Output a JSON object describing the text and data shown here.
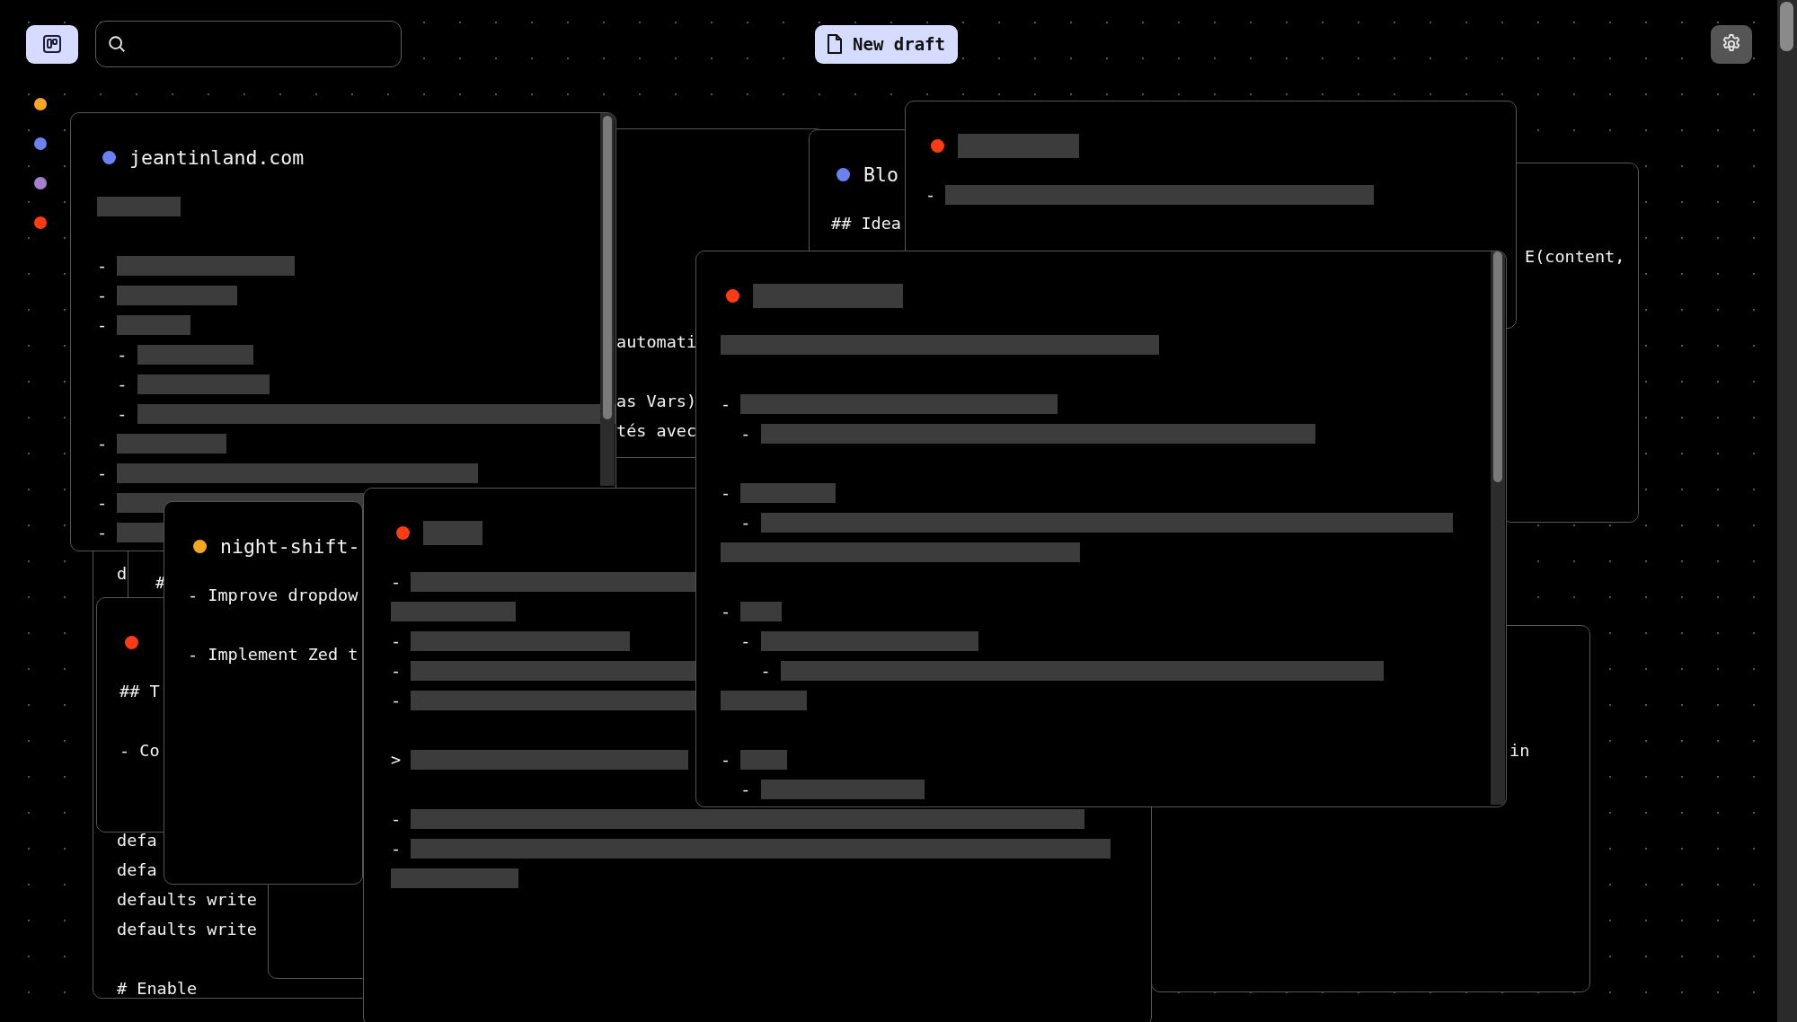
{
  "topbar": {
    "new_draft": {
      "label": "New draft"
    }
  },
  "sidebar": {
    "items": [
      {
        "color": "#f5a623"
      },
      {
        "color": "#6b82f0"
      },
      {
        "color": "#a77fd0"
      },
      {
        "color": "#ff3b13"
      }
    ]
  },
  "cards": [
    {
      "kind": "note",
      "lines": [
        {
          "kind": "text",
          "text": "d"
        },
        {
          "kind": "blank"
        },
        {
          "kind": "blank"
        },
        {
          "kind": "blank"
        },
        {
          "kind": "blank"
        },
        {
          "kind": "blank"
        },
        {
          "kind": "blank"
        },
        {
          "kind": "blank"
        },
        {
          "kind": "blank"
        },
        {
          "kind": "text",
          "text": "defa"
        },
        {
          "kind": "text",
          "text": "defa"
        },
        {
          "kind": "text",
          "text": "defaults write"
        },
        {
          "kind": "text",
          "text": "defaults write"
        },
        {
          "kind": "blank"
        },
        {
          "kind": "text",
          "text": "# Enable"
        }
      ]
    },
    {
      "kind": "note"
    },
    {
      "kind": "note",
      "lines": [
        {
          "kind": "text",
          "text": "#"
        }
      ]
    },
    {
      "kind": "note",
      "color": "#ff3b13",
      "lines": [
        {
          "kind": "text",
          "text": "## T"
        },
        {
          "kind": "blank"
        },
        {
          "kind": "text",
          "text": "- Co"
        }
      ]
    },
    {
      "kind": "note",
      "lines": [
        {
          "kind": "text",
          "text": "automati"
        },
        {
          "kind": "blank"
        },
        {
          "kind": "text",
          "text": "as Vars)"
        },
        {
          "kind": "text",
          "text": "tés avec"
        }
      ]
    },
    {
      "kind": "note",
      "lines": [
        {
          "kind": "text",
          "text": "E(content,"
        }
      ]
    },
    {
      "kind": "note",
      "lines": [
        {
          "kind": "text",
          "text": "in"
        }
      ]
    },
    {
      "kind": "note",
      "color": "#6b82f0",
      "header": {
        "kind": "text",
        "text": "Blo"
      },
      "lines": [
        {
          "kind": "text",
          "text": "## Idea"
        }
      ]
    },
    {
      "kind": "note",
      "color": "#6b82f0",
      "header": {
        "kind": "text",
        "text": "jeantinland.com"
      },
      "lines": [
        {
          "kind": "redacted"
        },
        {
          "kind": "blank"
        },
        {
          "kind": "redacted",
          "prefix": "- "
        },
        {
          "kind": "redacted",
          "prefix": "- "
        },
        {
          "kind": "redacted",
          "prefix": "- "
        },
        {
          "kind": "redacted",
          "prefix": "  - "
        },
        {
          "kind": "redacted",
          "prefix": "  - "
        },
        {
          "kind": "redacted",
          "prefix": "  - "
        },
        {
          "kind": "redacted",
          "prefix": "- "
        },
        {
          "kind": "redacted",
          "prefix": "- "
        },
        {
          "kind": "redacted",
          "prefix": "- "
        },
        {
          "kind": "redacted",
          "prefix": "- "
        }
      ]
    },
    {
      "kind": "note",
      "color": "#f5a623",
      "header": {
        "kind": "text",
        "text": "night-shift-"
      },
      "lines": [
        {
          "kind": "text",
          "text": "- Improve dropdow"
        },
        {
          "kind": "blank"
        },
        {
          "kind": "text",
          "text": "- Implement Zed t"
        }
      ]
    },
    {
      "kind": "note",
      "color": "#ff3b13",
      "header": {
        "kind": "redacted"
      },
      "lines": [
        {
          "kind": "redacted",
          "prefix": "- "
        },
        {
          "kind": "redacted"
        },
        {
          "kind": "redacted",
          "prefix": "- "
        },
        {
          "kind": "redacted",
          "prefix": "- "
        },
        {
          "kind": "redacted",
          "prefix": "- "
        },
        {
          "kind": "blank"
        },
        {
          "kind": "redacted",
          "prefix": "> "
        },
        {
          "kind": "blank"
        },
        {
          "kind": "redacted",
          "prefix": "- "
        },
        {
          "kind": "redacted",
          "prefix": "- "
        },
        {
          "kind": "redacted"
        }
      ]
    },
    {
      "kind": "note",
      "color": "#ff3b13",
      "header": {
        "kind": "redacted"
      },
      "lines": [
        {
          "kind": "redacted",
          "prefix": "- "
        }
      ]
    },
    {
      "kind": "note",
      "color": "#ff3b13",
      "header": {
        "kind": "redacted"
      },
      "lines": [
        {
          "kind": "redacted"
        },
        {
          "kind": "blank"
        },
        {
          "kind": "redacted",
          "prefix": "- "
        },
        {
          "kind": "redacted",
          "prefix": "  - "
        },
        {
          "kind": "blank"
        },
        {
          "kind": "redacted",
          "prefix": "- "
        },
        {
          "kind": "redacted",
          "prefix": "  - "
        },
        {
          "kind": "redacted"
        },
        {
          "kind": "blank"
        },
        {
          "kind": "redacted",
          "prefix": "- "
        },
        {
          "kind": "redacted",
          "prefix": "  - "
        },
        {
          "kind": "redacted",
          "prefix": "    - "
        },
        {
          "kind": "redacted"
        },
        {
          "kind": "blank"
        },
        {
          "kind": "redacted",
          "prefix": "- "
        },
        {
          "kind": "redacted",
          "prefix": "  - "
        }
      ]
    }
  ]
}
